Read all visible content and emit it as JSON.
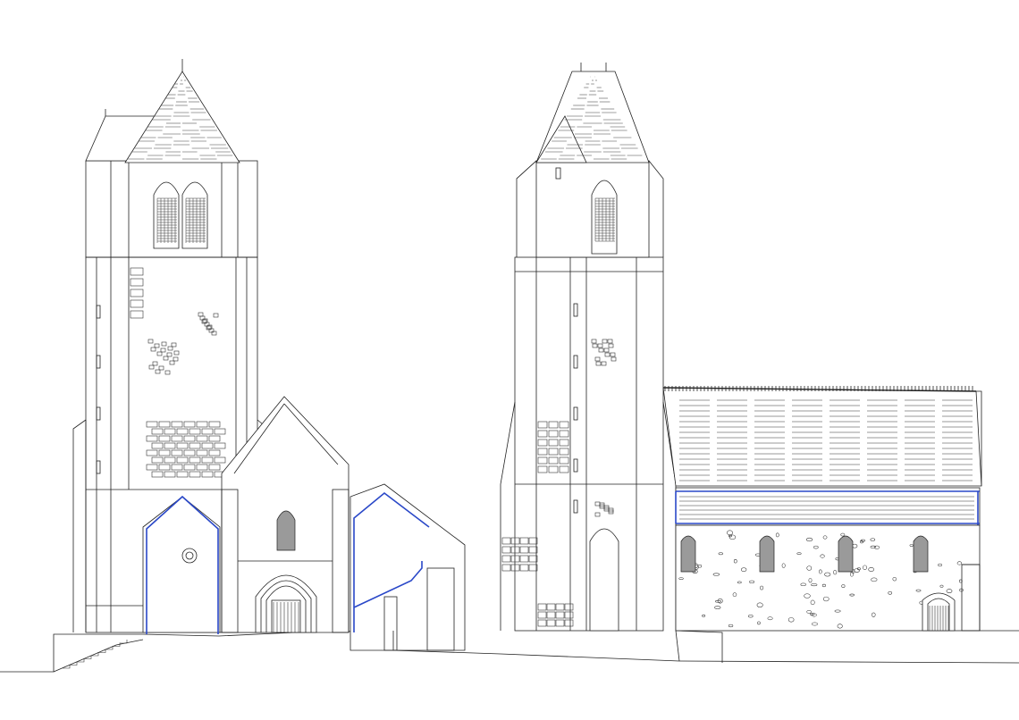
{
  "drawing": {
    "type": "architectural elevation",
    "line_color": "#222222",
    "section_color": "#2a48c8",
    "background": "#ffffff",
    "views": [
      {
        "name": "west-elevation",
        "elements": [
          "bell-tower",
          "spire",
          "west-facade",
          "romanesque-portal",
          "side-aisle-section"
        ]
      },
      {
        "name": "south-elevation",
        "elements": [
          "bell-tower",
          "spire",
          "nave-roof",
          "nave-wall",
          "windows",
          "side-door"
        ]
      }
    ],
    "annotations": [
      "",
      ""
    ]
  }
}
